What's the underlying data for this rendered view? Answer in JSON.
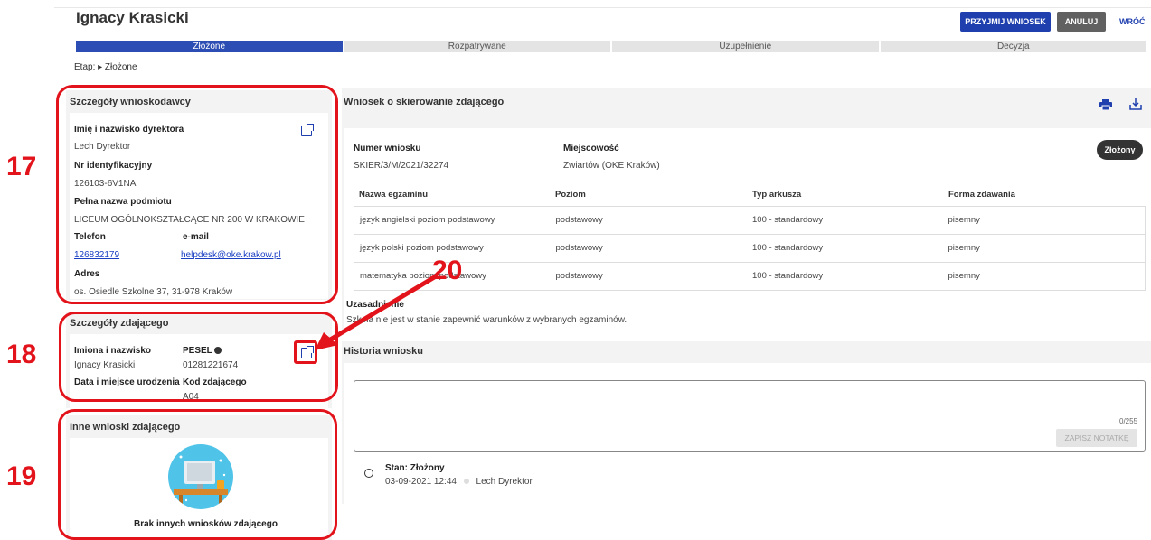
{
  "header": {
    "title": "Ignacy Krasicki",
    "accept_label": "PRZYJMIJ WNIOSEK",
    "cancel_label": "ANULUJ",
    "back_label": "WRÓĆ"
  },
  "stepper": [
    "Złożone",
    "Rozpatrywane",
    "Uzupełnienie",
    "Decyzja"
  ],
  "stage_text": "Etap: ▸ Złożone",
  "applicant": {
    "title": "Szczegóły wnioskodawcy",
    "director_label": "Imię i nazwisko dyrektora",
    "director_value": "Lech Dyrektor",
    "id_label": "Nr identyfikacyjny",
    "id_value": "126103-6V1NA",
    "entity_label": "Pełna nazwa podmiotu",
    "entity_value": "LICEUM OGÓLNOKSZTAŁCĄCE NR 200 W KRAKOWIE",
    "phone_label": "Telefon",
    "phone_value": "126832179",
    "email_label": "e-mail",
    "email_value": "helpdesk@oke.krakow.pl",
    "address_label": "Adres",
    "address_value": "os. Osiedle Szkolne 37, 31-978 Kraków"
  },
  "candidate": {
    "title": "Szczegóły zdającego",
    "name_label": "Imiona i nazwisko",
    "name_value": "Ignacy Krasicki",
    "pesel_label": "PESEL",
    "pesel_value": "01281221674",
    "birth_label": "Data i miejsce urodzenia",
    "code_label": "Kod zdającego",
    "code_value": "A04"
  },
  "other": {
    "title": "Inne wnioski zdającego",
    "empty_text": "Brak innych wniosków zdającego"
  },
  "request": {
    "title": "Wniosek o skierowanie zdającego",
    "number_label": "Numer wniosku",
    "number_value": "SKIER/3/M/2021/32274",
    "city_label": "Miejscowość",
    "city_value": "Zwiartów (OKE Kraków)",
    "status_badge": "Złożony",
    "columns": [
      "Nazwa egzaminu",
      "Poziom",
      "Typ arkusza",
      "Forma zdawania"
    ],
    "rows": [
      [
        "język angielski poziom podstawowy",
        "podstawowy",
        "100 - standardowy",
        "pisemny"
      ],
      [
        "język polski poziom podstawowy",
        "podstawowy",
        "100 - standardowy",
        "pisemny"
      ],
      [
        "matematyka poziom podstawowy",
        "podstawowy",
        "100 - standardowy",
        "pisemny"
      ]
    ],
    "justification_label": "Uzasadnienie",
    "justification_value": "Szkoła nie jest w stanie zapewnić warunków z wybranych egzaminów."
  },
  "history": {
    "title": "Historia wniosku",
    "counter": "0/255",
    "save_label": "ZAPISZ NOTATKĘ",
    "entry_state": "Stan: Złożony",
    "entry_date": "03-09-2021 12:44",
    "entry_user": "Lech Dyrektor"
  },
  "annotations": {
    "n17": "17",
    "n18": "18",
    "n19": "19",
    "n20": "20"
  },
  "colors": {
    "primary": "#1f3fae",
    "annotation": "#e3131b",
    "stepper_active": "#2c4db3"
  }
}
